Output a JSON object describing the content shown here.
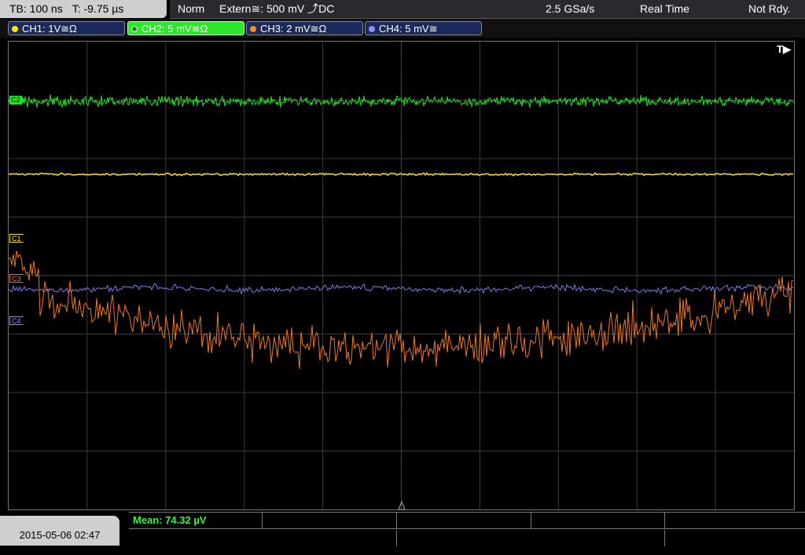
{
  "top": {
    "tb": "TB: 100 ns",
    "trig_time": "T: -9.75 µs",
    "mode": "Norm",
    "trigger": "Extern≅: 500 mV ⤴DC",
    "sample_rate": "2.5 GSa/s",
    "acq": "Real Time",
    "status": "Not Rdy."
  },
  "channels": [
    {
      "label": "CH1: 1V≅Ω",
      "color": "#ffe600"
    },
    {
      "label": "CH2: 5 mV≅Ω",
      "color": "#2ce62c"
    },
    {
      "label": "CH3: 2 mV≅Ω",
      "color": "#ff8c1a"
    },
    {
      "label": "CH4: 5 mV≅",
      "color": "#8d8dff"
    }
  ],
  "markers": {
    "ch2": "C2",
    "ch1": "C1",
    "ch3": "C3",
    "ch4": "C4",
    "trigger": "T▶"
  },
  "bottom": {
    "date": "2015-05-06 02:47",
    "mean": "Mean: 74.32 µV"
  },
  "colors": {
    "ch1": "#ffe600",
    "ch2": "#22dd22",
    "ch3": "#f07820",
    "ch4": "#7b7be6"
  }
}
